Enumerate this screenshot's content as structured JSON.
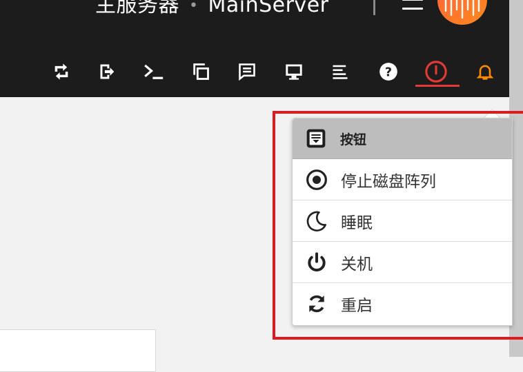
{
  "header": {
    "server_label": "主服务器",
    "separator": "•",
    "server_name": "MainServer"
  },
  "toolbar": {
    "icons": [
      "transfer-icon",
      "logout-icon",
      "terminal-icon",
      "copy-windows-icon",
      "message-icon",
      "monitor-icon",
      "log-list-icon",
      "help-icon",
      "power-icon",
      "bell-icon"
    ],
    "active": "power-icon"
  },
  "dropdown": {
    "header_label": "按钮",
    "items": [
      {
        "label": "停止磁盘阵列",
        "icon": "stop-array-icon"
      },
      {
        "label": "睡眠",
        "icon": "moon-icon"
      },
      {
        "label": "关机",
        "icon": "power-off-icon"
      },
      {
        "label": "重启",
        "icon": "restart-icon"
      }
    ]
  },
  "colors": {
    "topbar": "#1c1c1c",
    "accent_red": "#e53935",
    "bell_orange": "#ff8c00",
    "logo_orange": "#ff6a2c",
    "highlight": "#e0191e"
  }
}
